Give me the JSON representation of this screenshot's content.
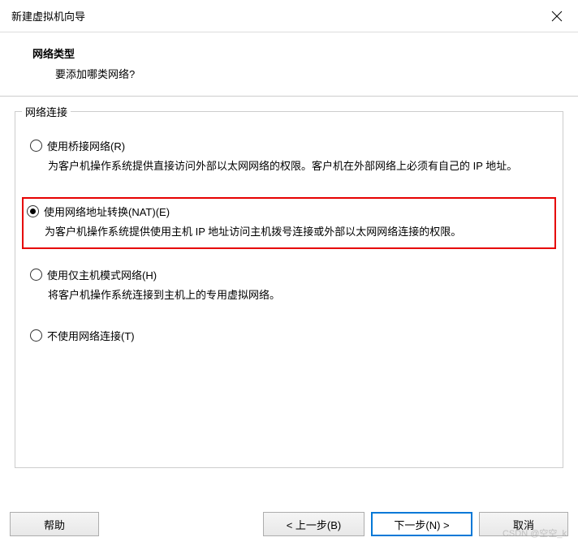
{
  "window": {
    "title": "新建虚拟机向导"
  },
  "header": {
    "title": "网络类型",
    "subtitle": "要添加哪类网络?"
  },
  "fieldset": {
    "legend": "网络连接"
  },
  "options": {
    "bridged": {
      "label": "使用桥接网络(R)",
      "desc": "为客户机操作系统提供直接访问外部以太网网络的权限。客户机在外部网络上必须有自己的 IP 地址。"
    },
    "nat": {
      "label": "使用网络地址转换(NAT)(E)",
      "desc": "为客户机操作系统提供使用主机 IP 地址访问主机拨号连接或外部以太网网络连接的权限。"
    },
    "hostonly": {
      "label": "使用仅主机模式网络(H)",
      "desc": "将客户机操作系统连接到主机上的专用虚拟网络。"
    },
    "none": {
      "label": "不使用网络连接(T)"
    }
  },
  "buttons": {
    "help": "帮助",
    "back": "< 上一步(B)",
    "next": "下一步(N) >",
    "cancel": "取消"
  },
  "watermark": "CSDN @空空_k"
}
